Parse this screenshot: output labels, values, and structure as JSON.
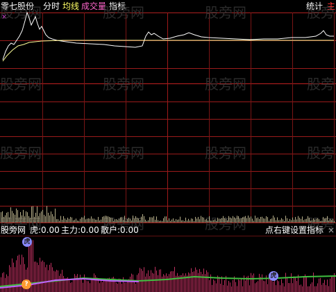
{
  "header": {
    "stock_name": "零七股份",
    "mode": "分时",
    "avg_line": "均线",
    "volume": "成交量",
    "indicator": "指标",
    "stats": "统计",
    "corner": "主"
  },
  "indicator_bar": {
    "name": "股旁网",
    "tiger": "虎:0.00",
    "main_force": "主力:0.00",
    "retail": "散户:0.00",
    "set_hint": "点右键设置指标",
    "close": "×"
  },
  "watermark": "股旁网",
  "colors": {
    "background": "#000000",
    "grid": "#8a1a1a",
    "price_line": "#ffffff",
    "avg_line": "#ffff99",
    "volume": "#b8b08a",
    "bars": "#c03060",
    "green_line": "#40c040",
    "purple_line": "#c060ff"
  },
  "icons": {
    "top_marker": "x-marker-icon",
    "badge_1": "tiger-badge-icon",
    "badge_2": "tiger-badge-icon",
    "badge_3": "question-badge-icon"
  }
}
